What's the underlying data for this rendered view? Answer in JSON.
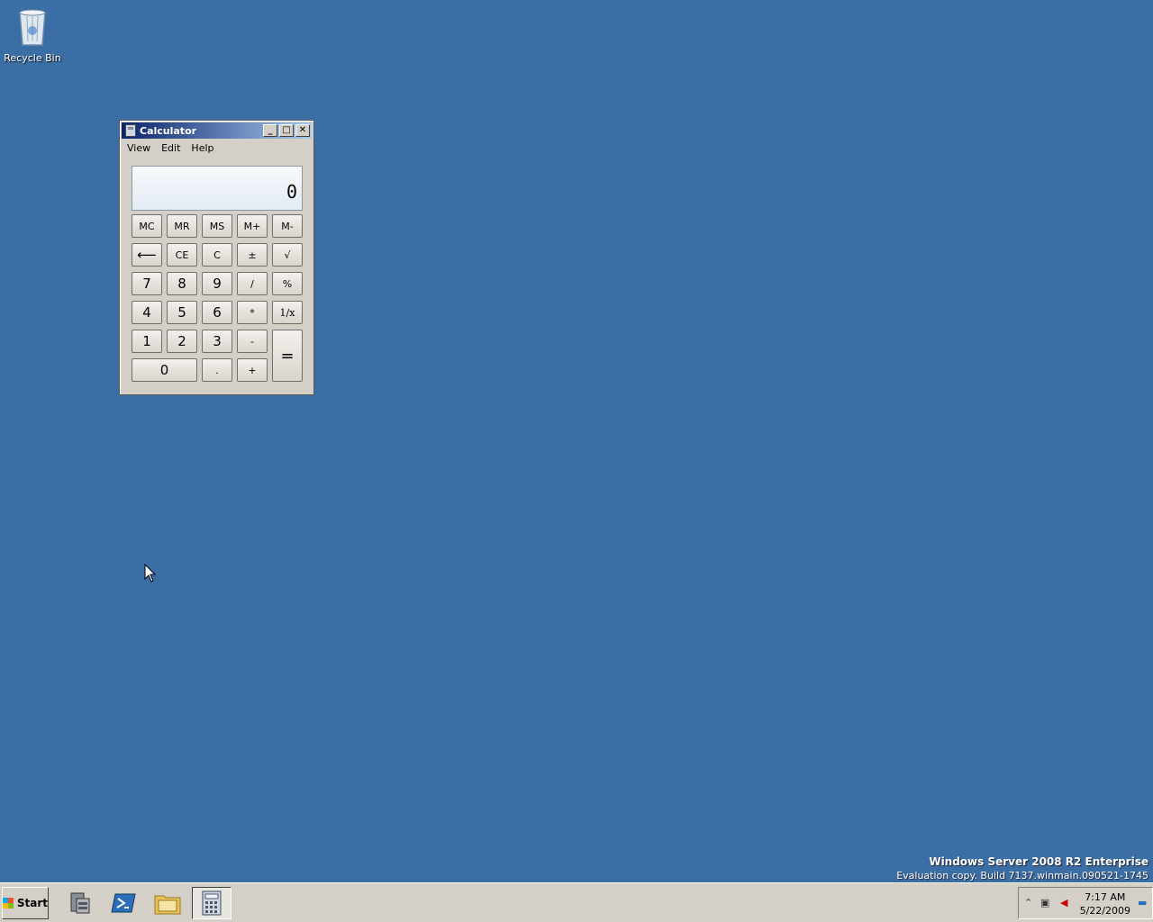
{
  "desktop": {
    "recycle_bin_label": "Recycle Bin",
    "watermark_line1": "Windows Server 2008 R2 Enterprise",
    "watermark_line2": "Evaluation copy. Build 7137.winmain.090521-1745"
  },
  "window": {
    "title": "Calculator",
    "controls": {
      "minimize": "_",
      "maximize": "□",
      "close": "✕"
    },
    "menu": [
      "View",
      "Edit",
      "Help"
    ],
    "display_value": "0"
  },
  "keys": {
    "mc": "MC",
    "mr": "MR",
    "ms": "MS",
    "mplus": "M+",
    "mminus": "M-",
    "backspace": "⟵",
    "ce": "CE",
    "c": "C",
    "plusminus": "±",
    "sqrt": "√",
    "k7": "7",
    "k8": "8",
    "k9": "9",
    "divide": "/",
    "percent": "%",
    "k4": "4",
    "k5": "5",
    "k6": "6",
    "multiply": "*",
    "reciprocal": "1/x",
    "k1": "1",
    "k2": "2",
    "k3": "3",
    "minus": "-",
    "equals": "=",
    "k0": "0",
    "decimal": ".",
    "plus": "+"
  },
  "taskbar": {
    "start_label": "Start",
    "clock_time": "7:17 AM",
    "clock_date": "5/22/2009"
  },
  "icons": {
    "recycle_bin": "recycle-bin-icon",
    "server_manager": "server-manager-icon",
    "powershell": "powershell-icon",
    "explorer": "folder-icon",
    "calculator": "calculator-icon"
  }
}
